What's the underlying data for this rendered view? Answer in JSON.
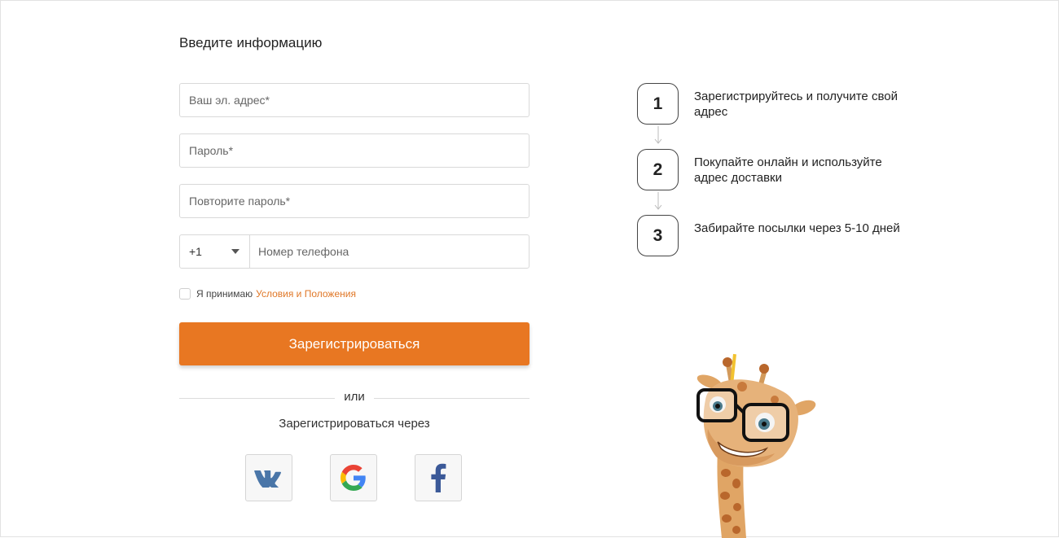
{
  "form": {
    "title": "Введите информацию",
    "email_placeholder": "Ваш эл. адрес*",
    "password_placeholder": "Пароль*",
    "repeat_password_placeholder": "Повторите пароль*",
    "country_code": "+1",
    "phone_placeholder": "Номер телефона",
    "terms_prefix": "Я принимаю",
    "terms_link": "Условия и Положения",
    "submit_label": "Зарегистрироваться",
    "or_label": "или",
    "register_via_label": "Зарегистрироваться через"
  },
  "social": [
    {
      "name": "vk",
      "icon": "vk-icon",
      "color": "#4a76a8"
    },
    {
      "name": "google",
      "icon": "google-icon",
      "color": "#4285f4"
    },
    {
      "name": "facebook",
      "icon": "facebook-icon",
      "color": "#3b5998"
    }
  ],
  "steps": [
    {
      "number": "1",
      "text": "Зарегистрируйтесь и получите свой адрес"
    },
    {
      "number": "2",
      "text": "Покупайте онлайн и используйте адрес доставки"
    },
    {
      "number": "3",
      "text": "Забирайте посылки через 5-10 дней"
    }
  ],
  "colors": {
    "accent": "#e87722",
    "link": "#e07726"
  },
  "illustration": "giraffe-with-glasses"
}
